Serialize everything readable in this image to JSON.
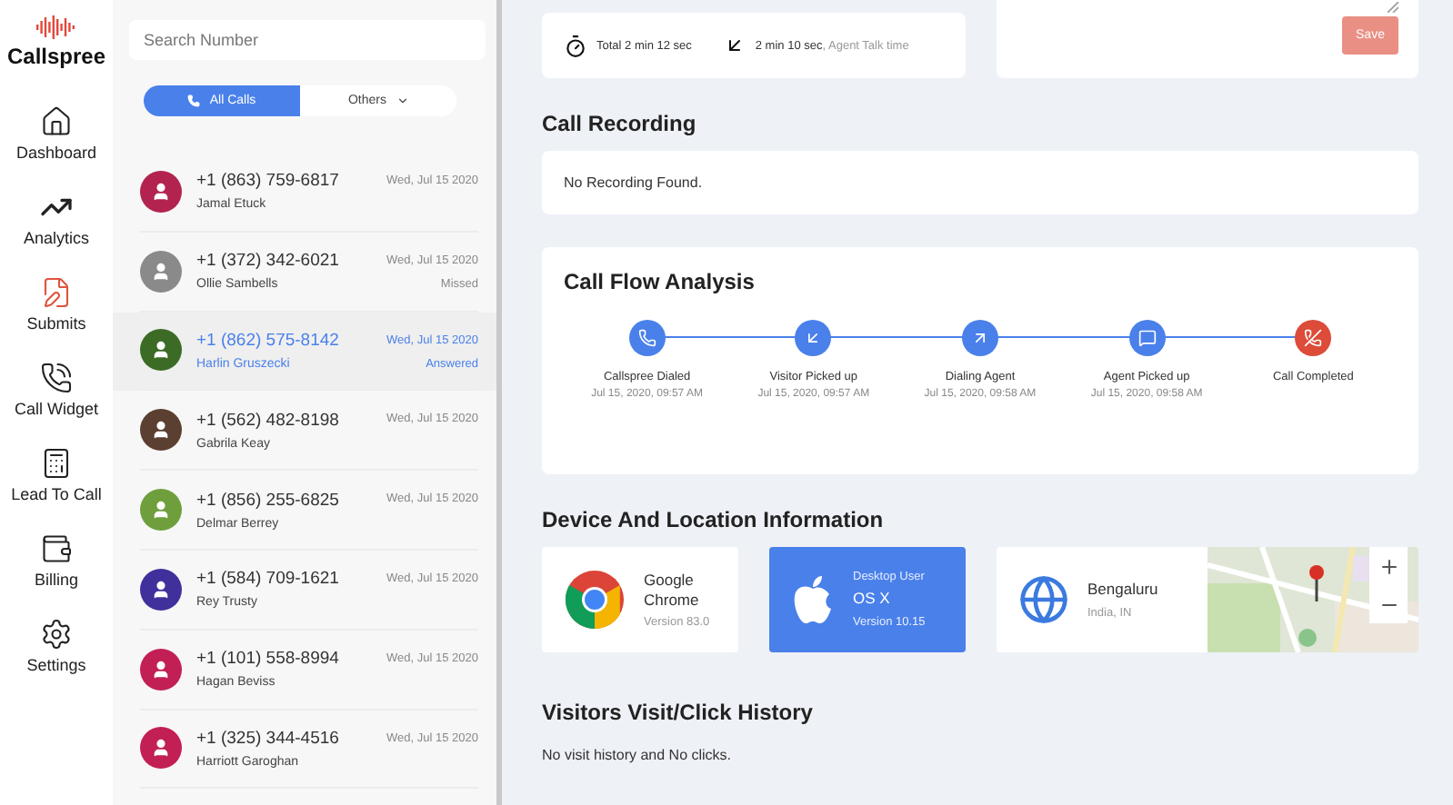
{
  "brand": {
    "name": "Callspree"
  },
  "nav": [
    {
      "kind": "home",
      "label": "Dashboard"
    },
    {
      "kind": "analytics",
      "label": "Analytics"
    },
    {
      "kind": "submits",
      "label": "Submits"
    },
    {
      "kind": "widget",
      "label": "Call Widget"
    },
    {
      "kind": "lead",
      "label": "Lead To Call"
    },
    {
      "kind": "billing",
      "label": "Billing"
    },
    {
      "kind": "settings",
      "label": "Settings"
    }
  ],
  "search": {
    "placeholder": "Search Number"
  },
  "filters": [
    {
      "kind": "calls",
      "label": "All Calls",
      "selected": true
    },
    {
      "kind": "menu",
      "label": "Others",
      "selected": false
    }
  ],
  "calls": [
    {
      "number": "+1 (863) 759-6817",
      "name": "Jamal Etuck",
      "date": "Wed, Jul 15 2020",
      "color": "#b3234f",
      "selected": false
    },
    {
      "number": "+1 (372) 342-6021",
      "name": "Ollie Sambells",
      "date": "Wed, Jul 15 2020",
      "status": "Missed",
      "color": "#8a8a8a",
      "selected": false
    },
    {
      "number": "+1 (862) 575-8142",
      "name": "Harlin Gruszecki",
      "date": "Wed, Jul 15 2020",
      "status": "Answered",
      "color": "#3b6b25",
      "selected": true
    },
    {
      "number": "+1 (562) 482-8198",
      "name": "Gabrila Keay",
      "date": "Wed, Jul 15 2020",
      "color": "#5b3f31",
      "selected": false
    },
    {
      "number": "+1 (856) 255-6825",
      "name": "Delmar Berrey",
      "date": "Wed, Jul 15 2020",
      "color": "#6e9f3c",
      "selected": false
    },
    {
      "number": "+1 (584) 709-1621",
      "name": "Rey Trusty",
      "date": "Wed, Jul 15 2020",
      "color": "#40309c",
      "selected": false
    },
    {
      "number": "+1 (101) 558-8994",
      "name": "Hagan Beviss",
      "date": "Wed, Jul 15 2020",
      "color": "#c21f55",
      "selected": false
    },
    {
      "number": "+1 (325) 344-4516",
      "name": "Harriott Garoghan",
      "date": "Wed, Jul 15 2020",
      "color": "#c21f55",
      "selected": false
    }
  ],
  "durations": {
    "total": "Total 2 min 12 sec",
    "talk": "2 min 10 sec",
    "talk_note": ", Agent Talk time"
  },
  "notes": {
    "save": "Save"
  },
  "recording": {
    "title": "Call Recording",
    "message": "No Recording Found."
  },
  "flow": {
    "title": "Call Flow Analysis",
    "steps": [
      {
        "kind": "dialed",
        "label": "Callspree Dialed",
        "time": "Jul 15, 2020, 09:57 AM",
        "color": "#4a80ea"
      },
      {
        "kind": "incoming",
        "label": "Visitor Picked up",
        "time": "Jul 15, 2020, 09:57 AM",
        "color": "#4a80ea"
      },
      {
        "kind": "outgoing",
        "label": "Dialing Agent",
        "time": "Jul 15, 2020, 09:58 AM",
        "color": "#4a80ea"
      },
      {
        "kind": "message",
        "label": "Agent Picked up",
        "time": "Jul 15, 2020, 09:58 AM",
        "color": "#4a80ea"
      },
      {
        "kind": "hangup",
        "label": "Call Completed",
        "color": "#dd4b39"
      }
    ]
  },
  "device": {
    "title": "Device And Location Information",
    "cards": [
      {
        "kind": "browser",
        "title": "Google Chrome",
        "sub": "Version 83.0",
        "highlighted": false
      },
      {
        "kind": "os",
        "label": "Desktop User",
        "title": "OS X",
        "sub": "Version 10.15",
        "highlighted": true
      },
      {
        "kind": "location",
        "title": "Bengaluru",
        "sub": "India, IN",
        "highlighted": false
      }
    ]
  },
  "history": {
    "title": "Visitors Visit/Click History",
    "message": "No visit history and No clicks."
  }
}
